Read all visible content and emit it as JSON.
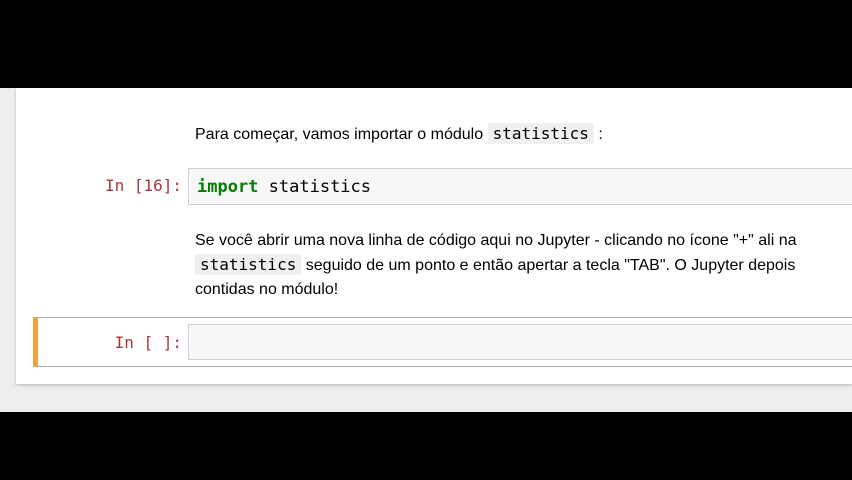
{
  "cells": {
    "md1": {
      "text_before": "Para começar, vamos importar o módulo ",
      "code": "statistics",
      "text_after": ":"
    },
    "code1": {
      "prompt": "In [16]:",
      "keyword": "import",
      "rest": " statistics"
    },
    "md2": {
      "line1": "Se você abrir uma nova linha de código aqui no Jupyter - clicando no ícone \"+\" ali na",
      "line2_code": "statistics",
      "line2_text": " seguido de um ponto e então apertar a tecla \"TAB\". O Jupyter depois",
      "line3": "contidas no módulo!"
    },
    "code2": {
      "prompt": "In [ ]:",
      "value": ""
    }
  },
  "colors": {
    "prompt": "#a63a3a",
    "keyword": "#008000",
    "selected_border": "#f0a33a",
    "input_bg": "#f7f7f7"
  }
}
